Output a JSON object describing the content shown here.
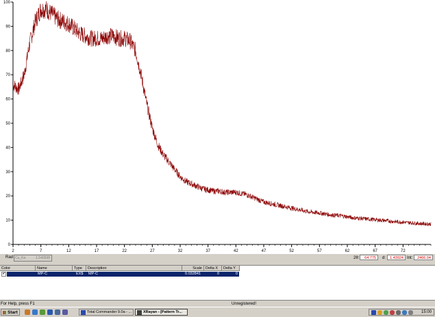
{
  "chart_data": {
    "type": "line",
    "series": [
      {
        "color": "#8b0000",
        "x": [
          2,
          3,
          4,
          5,
          6,
          7,
          8,
          9,
          10,
          11,
          12,
          13,
          14,
          15,
          16,
          17,
          18,
          19,
          20,
          21,
          22,
          23,
          24,
          25,
          26,
          27,
          28,
          29,
          30,
          31,
          32,
          33,
          34,
          35,
          36,
          37,
          38,
          39,
          40,
          41,
          42,
          43,
          44,
          45,
          46,
          47,
          48,
          49,
          50,
          51,
          52,
          53,
          54,
          55,
          56,
          57,
          58,
          59,
          60,
          61,
          62,
          63,
          64,
          65,
          66,
          67,
          68,
          69,
          70,
          71,
          72,
          73,
          74,
          75,
          76,
          77
        ],
        "y": [
          66,
          64,
          70,
          83,
          92,
          97,
          97,
          95,
          93,
          92,
          91,
          89,
          87,
          86,
          85,
          85,
          85,
          86,
          86,
          85,
          85,
          84,
          80,
          70,
          58,
          48,
          41,
          37,
          34,
          31,
          28,
          26,
          25,
          24,
          23,
          22.5,
          22,
          22,
          21.5,
          21.5,
          21.5,
          21,
          20.5,
          19.5,
          18.5,
          17.5,
          17,
          16.5,
          16,
          15.5,
          15,
          14.5,
          14,
          13.5,
          13.2,
          13,
          12.6,
          12.2,
          12,
          11.8,
          11.4,
          11,
          10.8,
          10.6,
          10.4,
          10.2,
          10,
          9.8,
          9.5,
          9.3,
          9.2,
          9,
          8.8,
          8.6,
          8.5,
          8.4
        ]
      }
    ],
    "x_ticks": [
      "2",
      "7",
      "12",
      "17",
      "22",
      "27",
      "32",
      "37",
      "42",
      "47",
      "52",
      "57",
      "62",
      "67",
      "72"
    ],
    "y_ticks": [
      "0",
      "10",
      "20",
      "30",
      "40",
      "50",
      "60",
      "70",
      "80",
      "90",
      "100"
    ],
    "xlim": [
      2,
      77
    ],
    "ylim": [
      0,
      100
    ],
    "grid": false
  },
  "readout": {
    "rad_label": "Rad",
    "rad_source": "Cu_Kα",
    "rad_value": "1.540598",
    "two_theta_label": "2θ:",
    "two_theta_value": "64.775",
    "d_label": "d:",
    "d_value": "1.43924",
    "int_label": "Int:",
    "int_value": "2466.04"
  },
  "table": {
    "headers": [
      "Color",
      "Name",
      "Type",
      "Description",
      "Scale",
      "Delta X",
      "Delta Y"
    ],
    "rows": [
      {
        "check": "✔",
        "name": "MP-C",
        "type": "EX$",
        "description": "MP-C",
        "scale": "0.032841",
        "delta_x": "0",
        "delta_y": "0"
      }
    ]
  },
  "status": {
    "help_text": "For Help, press F1",
    "registration": "Unregistered!"
  },
  "taskbar": {
    "start_label": "Start",
    "tasks": [
      {
        "label": "Total Commander 9.0a - ...",
        "active": false
      },
      {
        "label": "XRayan - [Pattern Tr...",
        "active": true
      }
    ],
    "clock": "15:00"
  }
}
